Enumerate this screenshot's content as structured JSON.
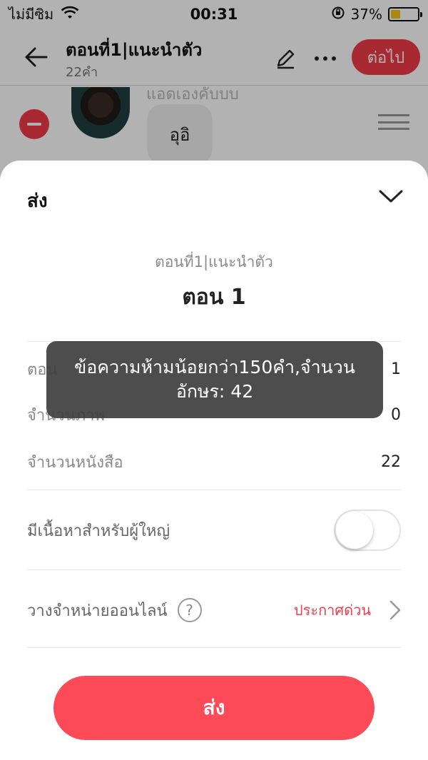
{
  "status_bar": {
    "carrier": "ไม่มีซิม",
    "time": "00:31",
    "battery_percent": "37%",
    "battery_level": 0.37
  },
  "nav": {
    "title": "ตอนที่1|แนะนำตัว",
    "subtitle": "22คำ",
    "next_label": "ต่อไป"
  },
  "content": {
    "speaker_name": "แอดเองคับบบ",
    "bubble_text": "อุอิ"
  },
  "sheet": {
    "title": "ส่ง",
    "chapter_subtitle": "ตอนที่1|แนะนำตัว",
    "chapter_name": "ตอน 1",
    "rows": [
      {
        "label": "ตอน",
        "value": "1"
      },
      {
        "label": "จำนวนภาพ",
        "value": "0"
      },
      {
        "label": "จำนวนหนังสือ",
        "value": "22"
      }
    ],
    "adult_label": "มีเนื้อหาสำหรับผู้ใหญ่",
    "adult_enabled": false,
    "sell_label": "วางจำหน่ายออนไลน์",
    "sell_help": "?",
    "sell_status": "ประกาศด่วน",
    "send_label": "ส่ง"
  },
  "toast": {
    "message": "ข้อความห้ามน้อยกว่า150คำ,จำนวนอักษร: 42"
  },
  "colors": {
    "accent": "#f23c4a",
    "send_button": "#fd4a58",
    "overlay": "rgba(0,0,0,0.30)"
  }
}
